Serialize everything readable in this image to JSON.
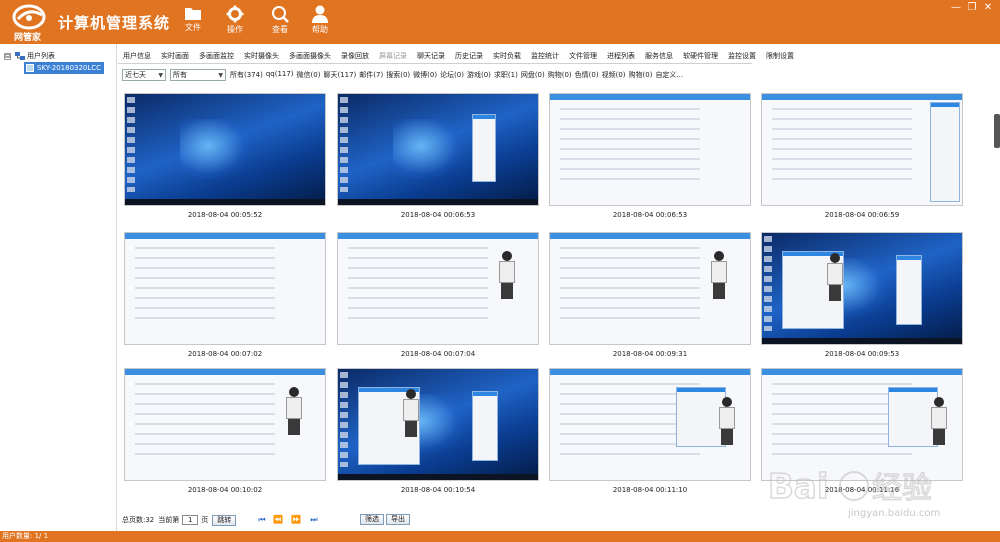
{
  "app": {
    "title": "计算机管理系统",
    "logo_text": "网管家",
    "colors": {
      "header": "#e07421",
      "selection": "#3b80d4"
    }
  },
  "toolbar": [
    {
      "label": "文件",
      "icon": "folder-icon"
    },
    {
      "label": "操作",
      "icon": "gear-icon"
    },
    {
      "label": "查看",
      "icon": "search-icon"
    },
    {
      "label": "帮助",
      "icon": "user-icon"
    }
  ],
  "window_controls": {
    "minimize": "—",
    "restore": "❐",
    "close": "✕"
  },
  "tree": {
    "root_label": "用户列表",
    "toggle": "⊟",
    "child_label": "SKY-20180320LCC"
  },
  "tabs": [
    {
      "label": "用户信息",
      "enabled": true
    },
    {
      "label": "实时画面",
      "enabled": true
    },
    {
      "label": "多画面监控",
      "enabled": true
    },
    {
      "label": "实时摄像头",
      "enabled": true
    },
    {
      "label": "多画面摄像头",
      "enabled": true
    },
    {
      "label": "录像回放",
      "enabled": true
    },
    {
      "label": "屏幕记录",
      "enabled": false
    },
    {
      "label": "聊天记录",
      "enabled": true
    },
    {
      "label": "历史记录",
      "enabled": true
    },
    {
      "label": "实时负载",
      "enabled": true
    },
    {
      "label": "监控统计",
      "enabled": true
    },
    {
      "label": "文件管理",
      "enabled": true
    },
    {
      "label": "进程列表",
      "enabled": true
    },
    {
      "label": "服务信息",
      "enabled": true
    },
    {
      "label": "软硬件管理",
      "enabled": true
    },
    {
      "label": "监控设置",
      "enabled": true
    },
    {
      "label": "限制设置",
      "enabled": true
    }
  ],
  "filters": {
    "period": "近七天",
    "type": "所有",
    "categories": [
      "所有(374)",
      "qq(117)",
      "微信(0)",
      "聊天(117)",
      "邮件(7)",
      "搜索(0)",
      "微博(0)",
      "论坛(0)",
      "游戏(0)",
      "求职(1)",
      "网盘(0)",
      "购物(0)",
      "色情(0)",
      "视频(0)",
      "购物(0)",
      "自定义..."
    ]
  },
  "screenshots": [
    {
      "time": "2018-08-04 00:05:52",
      "kind": "desktop"
    },
    {
      "time": "2018-08-04 00:06:53",
      "kind": "desktop-chat"
    },
    {
      "time": "2018-08-04 00:06:53",
      "kind": "list"
    },
    {
      "time": "2018-08-04 00:06:59",
      "kind": "chat-list"
    },
    {
      "time": "2018-08-04 00:07:02",
      "kind": "chat"
    },
    {
      "time": "2018-08-04 00:07:04",
      "kind": "chat-person"
    },
    {
      "time": "2018-08-04 00:09:31",
      "kind": "chat-person"
    },
    {
      "time": "2018-08-04 00:09:53",
      "kind": "desktop-person"
    },
    {
      "time": "2018-08-04 00:10:02",
      "kind": "chat-person"
    },
    {
      "time": "2018-08-04 00:10:54",
      "kind": "desktop-person"
    },
    {
      "time": "2018-08-04 00:11:10",
      "kind": "chat-menu"
    },
    {
      "time": "2018-08-04 00:11:16",
      "kind": "chat-menu"
    }
  ],
  "pager": {
    "total_label": "总页数:32",
    "current_label": "当前第",
    "current_page": "1",
    "page_suffix": "页",
    "jump_label": "跳转",
    "filter_label": "筛选",
    "export_label": "导出"
  },
  "status": {
    "user_count": "用户数量: 1/ 1"
  },
  "watermark": {
    "text": "jingyan.baidu.com"
  }
}
